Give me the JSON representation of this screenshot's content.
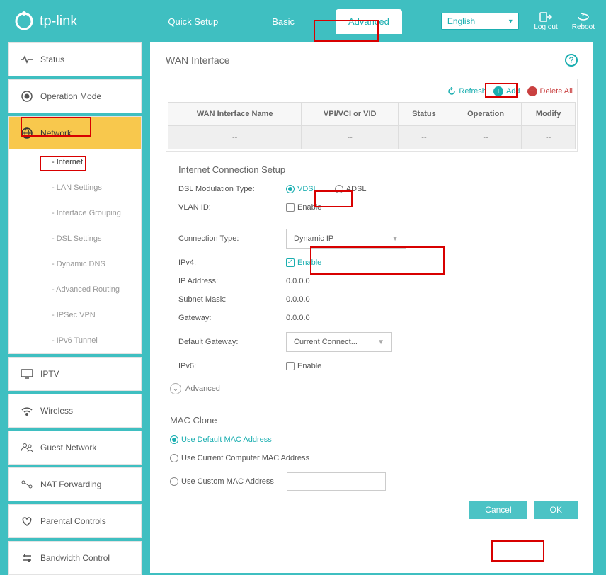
{
  "brand": "tp-link",
  "topnav": {
    "quick": "Quick Setup",
    "basic": "Basic",
    "advanced": "Advanced"
  },
  "lang": "English",
  "top_actions": {
    "logout": "Log out",
    "reboot": "Reboot"
  },
  "sidebar": {
    "status": "Status",
    "opmode": "Operation Mode",
    "network": "Network",
    "subs": {
      "internet": "- Internet",
      "lan": "- LAN Settings",
      "ifgroup": "- Interface Grouping",
      "dsl": "- DSL Settings",
      "ddns": "- Dynamic DNS",
      "advrouting": "- Advanced Routing",
      "ipsec": "- IPSec VPN",
      "ipv6tunnel": "- IPv6 Tunnel"
    },
    "iptv": "IPTV",
    "wireless": "Wireless",
    "guest": "Guest Network",
    "nat": "NAT Forwarding",
    "parental": "Parental Controls",
    "bw": "Bandwidth Control"
  },
  "page_title": "WAN Interface",
  "actions": {
    "refresh": "Refresh",
    "add": "Add",
    "delall": "Delete All"
  },
  "table": {
    "h1": "WAN Interface Name",
    "h2": "VPI/VCI or VID",
    "h3": "Status",
    "h4": "Operation",
    "h5": "Modify",
    "empty": "--"
  },
  "setup_title": "Internet Connection Setup",
  "dslmod": {
    "label": "DSL Modulation Type:",
    "vdsl": "VDSL",
    "adsl": "ADSL"
  },
  "vlan": {
    "label": "VLAN ID:",
    "enable": "Enable"
  },
  "conntype": {
    "label": "Connection Type:",
    "value": "Dynamic IP"
  },
  "ipv4": {
    "label": "IPv4:",
    "enable": "Enable"
  },
  "ipaddr": {
    "label": "IP Address:",
    "value": "0.0.0.0"
  },
  "subnet": {
    "label": "Subnet Mask:",
    "value": "0.0.0.0"
  },
  "gateway": {
    "label": "Gateway:",
    "value": "0.0.0.0"
  },
  "defgw": {
    "label": "Default Gateway:",
    "value": "Current Connect..."
  },
  "ipv6": {
    "label": "IPv6:",
    "enable": "Enable"
  },
  "advanced_toggle": "Advanced",
  "macclone": {
    "title": "MAC Clone",
    "default": "Use Default MAC Address",
    "current": "Use Current Computer MAC Address",
    "custom": "Use Custom MAC Address"
  },
  "buttons": {
    "cancel": "Cancel",
    "ok": "OK"
  }
}
